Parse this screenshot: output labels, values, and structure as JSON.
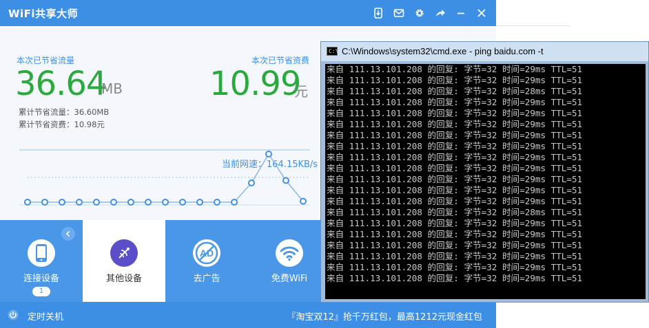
{
  "app": {
    "title": "WiFi共享大师",
    "saved_traffic_label": "本次已节省流量",
    "saved_traffic_value": "36.64",
    "saved_traffic_unit": "MB",
    "saved_cost_label": "本次已节省资费",
    "saved_cost_value": "10.99",
    "saved_cost_unit": "元",
    "total_traffic": "累计节省流量：36.60MB",
    "total_cost": "累计节省资费：10.98元",
    "speed": "当前网速：164.15KB/s"
  },
  "chart_data": {
    "type": "line",
    "title": "",
    "xlabel": "",
    "ylabel": "",
    "ylim": [
      0,
      100
    ],
    "x": [
      1,
      2,
      3,
      4,
      5,
      6,
      7,
      8,
      9,
      10,
      11,
      12,
      13,
      14,
      15,
      16,
      17
    ],
    "values": [
      0,
      0,
      0,
      0,
      0,
      0,
      0,
      0,
      0,
      0,
      0,
      0,
      0,
      40,
      100,
      45,
      2
    ],
    "grid": false,
    "colors": {
      "line": "#8ab8ea",
      "point_fill": "#ffffff",
      "point_stroke": "#3d8fe6"
    }
  },
  "nav": {
    "items": [
      {
        "label": "连接设备",
        "badge": "1",
        "icon": "phone-icon"
      },
      {
        "label": "其他设备",
        "icon": "satellite-icon"
      },
      {
        "label": "去广告",
        "icon": "ad-block-icon"
      },
      {
        "label": "免费WiFi",
        "icon": "wifi-icon"
      }
    ]
  },
  "footer": {
    "timer_label": "定时关机",
    "promo": "『淘宝双12』抢千万红包，最高1212元现金红包"
  },
  "cmd": {
    "title": "C:\\Windows\\system32\\cmd.exe - ping  baidu.com  -t",
    "icon_text": "C:\\",
    "lines": [
      "来自 111.13.101.208 的回复: 字节=32 时间=29ms TTL=51",
      "来自 111.13.101.208 的回复: 字节=32 时间=29ms TTL=51",
      "来自 111.13.101.208 的回复: 字节=32 时间=28ms TTL=51",
      "来自 111.13.101.208 的回复: 字节=32 时间=29ms TTL=51",
      "来自 111.13.101.208 的回复: 字节=32 时间=29ms TTL=51",
      "来自 111.13.101.208 的回复: 字节=32 时间=29ms TTL=51",
      "来自 111.13.101.208 的回复: 字节=32 时间=29ms TTL=51",
      "来自 111.13.101.208 的回复: 字节=32 时间=29ms TTL=51",
      "来自 111.13.101.208 的回复: 字节=32 时间=29ms TTL=51",
      "来自 111.13.101.208 的回复: 字节=32 时间=29ms TTL=51",
      "来自 111.13.101.208 的回复: 字节=32 时间=29ms TTL=51",
      "来自 111.13.101.208 的回复: 字节=32 时间=29ms TTL=51",
      "来自 111.13.101.208 的回复: 字节=32 时间=29ms TTL=51",
      "来自 111.13.101.208 的回复: 字节=32 时间=28ms TTL=51",
      "来自 111.13.101.208 的回复: 字节=32 时间=29ms TTL=51",
      "来自 111.13.101.208 的回复: 字节=32 时间=29ms TTL=51",
      "来自 111.13.101.208 的回复: 字节=32 时间=29ms TTL=51",
      "来自 111.13.101.208 的回复: 字节=32 时间=29ms TTL=51",
      "来自 111.13.101.208 的回复: 字节=32 时间=29ms TTL=51",
      "来自 111.13.101.208 的回复: 字节=32 时间=29ms TTL=51"
    ]
  },
  "colors": {
    "brand": "#3d8fe6",
    "accent_green": "#2aaa3c"
  }
}
